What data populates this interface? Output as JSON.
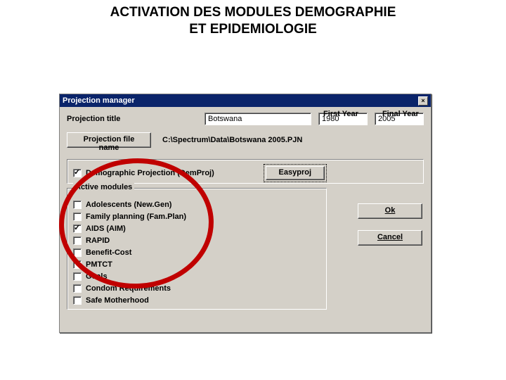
{
  "slide": {
    "title_line1": "ACTIVATION DES MODULES DEMOGRAPHIE",
    "title_line2": "ET EPIDEMIOLOGIE"
  },
  "dialog": {
    "title": "Projection manager",
    "close": "✕",
    "labels": {
      "projection_title": "Projection title",
      "first_year": "First Year",
      "final_year": "Final Year",
      "file_name_btn": "Projection file name",
      "easyproj": "Easyproj",
      "ok": "Ok",
      "cancel": "Cancel"
    },
    "inputs": {
      "title": "Botswana",
      "first_year": "1980",
      "final_year": "2005"
    },
    "file_path": "C:\\Spectrum\\Data\\Botswana 2005.PJN",
    "demproj": {
      "label": "Demographic Projection (DemProj)",
      "checked": true
    },
    "modules": {
      "legend": "Active modules",
      "items": [
        {
          "label": "Adolescents (New.Gen)",
          "checked": false
        },
        {
          "label": "Family planning (Fam.Plan)",
          "checked": false
        },
        {
          "label": "AIDS (AIM)",
          "checked": true
        },
        {
          "label": "RAPID",
          "checked": false
        },
        {
          "label": "Benefit-Cost",
          "checked": false
        },
        {
          "label": "PMTCT",
          "checked": false
        },
        {
          "label": "Goals",
          "checked": false
        },
        {
          "label": "Condom Requirements",
          "checked": false
        },
        {
          "label": "Safe Motherhood",
          "checked": false
        }
      ]
    }
  }
}
